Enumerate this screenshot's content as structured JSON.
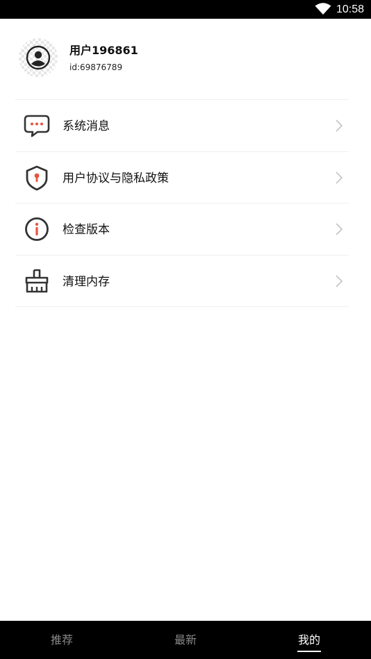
{
  "status_bar": {
    "time": "10:58",
    "wifi_icon": "wifi-icon"
  },
  "profile": {
    "username": "用户196861",
    "user_id": "id:69876789",
    "avatar_icon": "user-avatar-icon"
  },
  "menu": {
    "items": [
      {
        "label": "系统消息",
        "icon": "message-icon"
      },
      {
        "label": "用户协议与隐私政策",
        "icon": "shield-icon"
      },
      {
        "label": "检查版本",
        "icon": "info-icon"
      },
      {
        "label": "清理内存",
        "icon": "broom-icon"
      }
    ]
  },
  "bottom_nav": {
    "tabs": [
      {
        "label": "推荐",
        "active": false
      },
      {
        "label": "最新",
        "active": false
      },
      {
        "label": "我的",
        "active": true
      }
    ]
  },
  "colors": {
    "accent": "#e8533f",
    "icon_dark": "#333333",
    "nav_bg": "#000000"
  }
}
